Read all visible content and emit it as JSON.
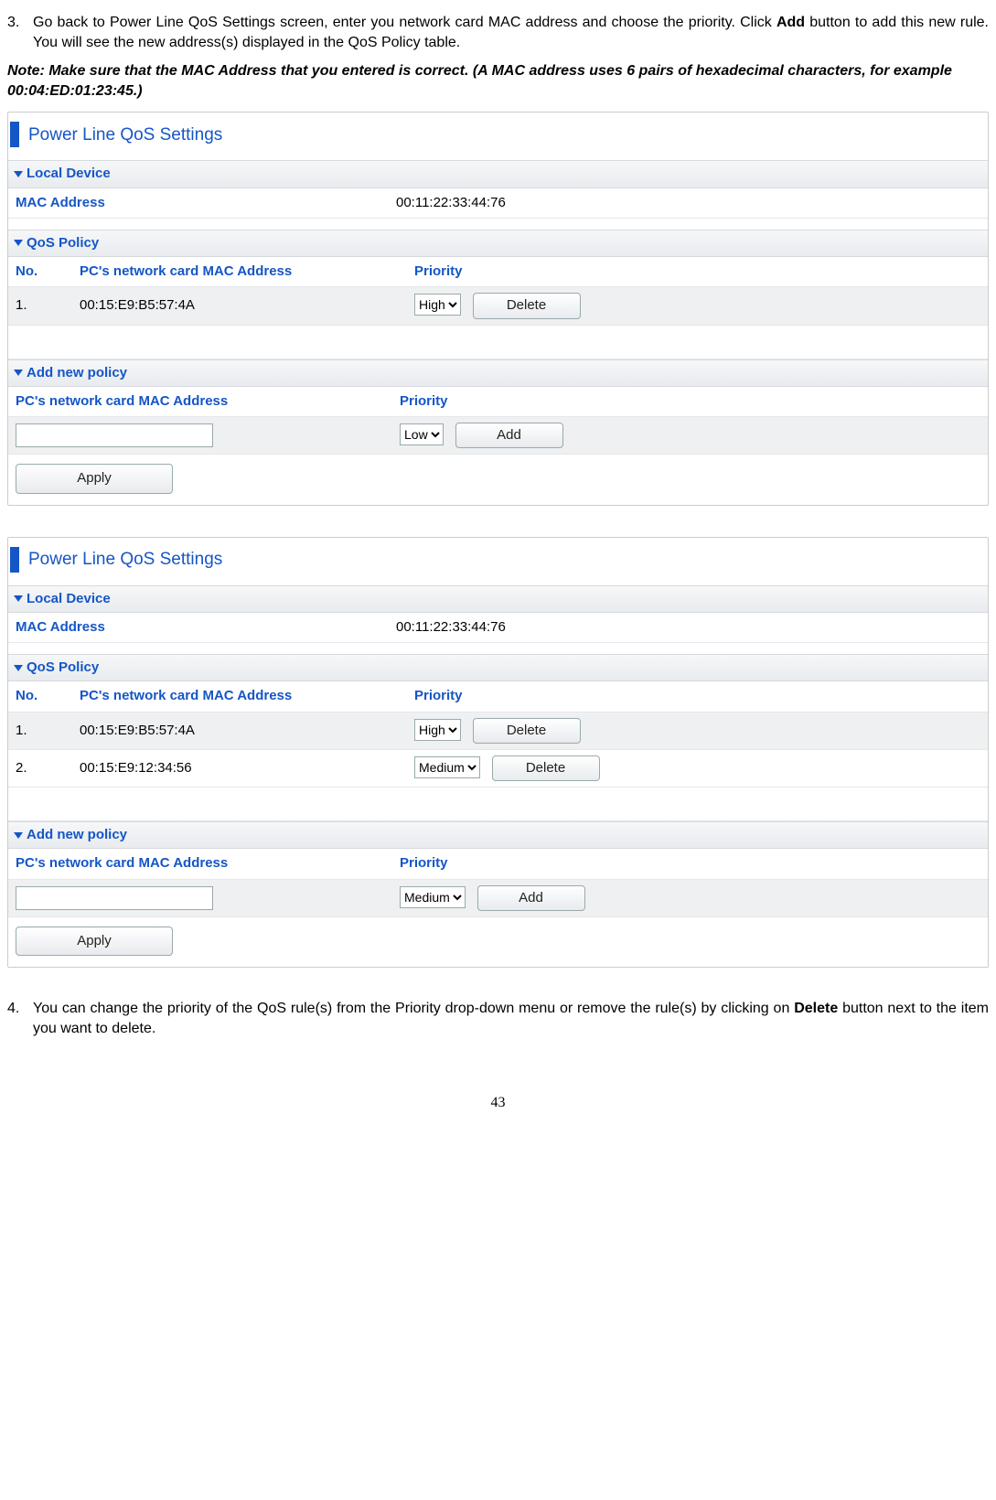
{
  "step3": {
    "num": "3.",
    "text_a": "Go back to Power Line QoS Settings screen, enter you network card MAC address and choose the priority. Click ",
    "bold": "Add",
    "text_b": " button to add this new rule. You will see the new address(s) displayed in the QoS Policy table."
  },
  "note": "Note: Make sure that the MAC Address that you entered is correct. (A MAC address uses 6 pairs of hexadecimal characters, for example 00:04:ED:01:23:45.)",
  "panel_title": "Power Line QoS Settings",
  "sections": {
    "local_device": "Local Device",
    "qos_policy": "QoS Policy",
    "add_new": "Add new policy"
  },
  "labels": {
    "mac_address": "MAC Address",
    "no": "No.",
    "pc_mac": "PC's network card MAC Address",
    "priority": "Priority",
    "delete": "Delete",
    "add": "Add",
    "apply": "Apply"
  },
  "local_mac": "00:11:22:33:44:76",
  "priority_options": [
    "High",
    "Medium",
    "Low"
  ],
  "panel1": {
    "rows": [
      {
        "no": "1.",
        "mac": "00:15:E9:B5:57:4A",
        "priority": "High"
      }
    ],
    "add_priority": "Low",
    "add_mac": ""
  },
  "panel2": {
    "rows": [
      {
        "no": "1.",
        "mac": "00:15:E9:B5:57:4A",
        "priority": "High"
      },
      {
        "no": "2.",
        "mac": "00:15:E9:12:34:56",
        "priority": "Medium"
      }
    ],
    "add_priority": "Medium",
    "add_mac": ""
  },
  "step4": {
    "num": "4.",
    "text_a": "You can change the priority of the QoS rule(s) from the Priority drop-down menu or remove the rule(s) by clicking on ",
    "bold": "Delete",
    "text_b": " button next to the item you want to delete."
  },
  "page_number": "43"
}
